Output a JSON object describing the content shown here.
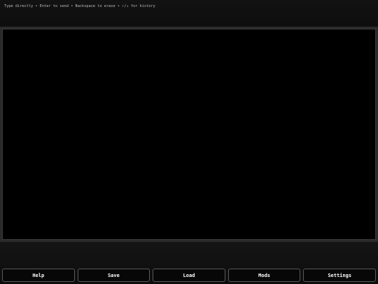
{
  "header": {
    "hint": "Type directly • Enter to send • Backspace to erase • ↑/↓ for history"
  },
  "toolbar": {
    "buttons": [
      {
        "label": "Help"
      },
      {
        "label": "Save"
      },
      {
        "label": "Load"
      },
      {
        "label": "Mods"
      },
      {
        "label": "Settings"
      }
    ]
  }
}
